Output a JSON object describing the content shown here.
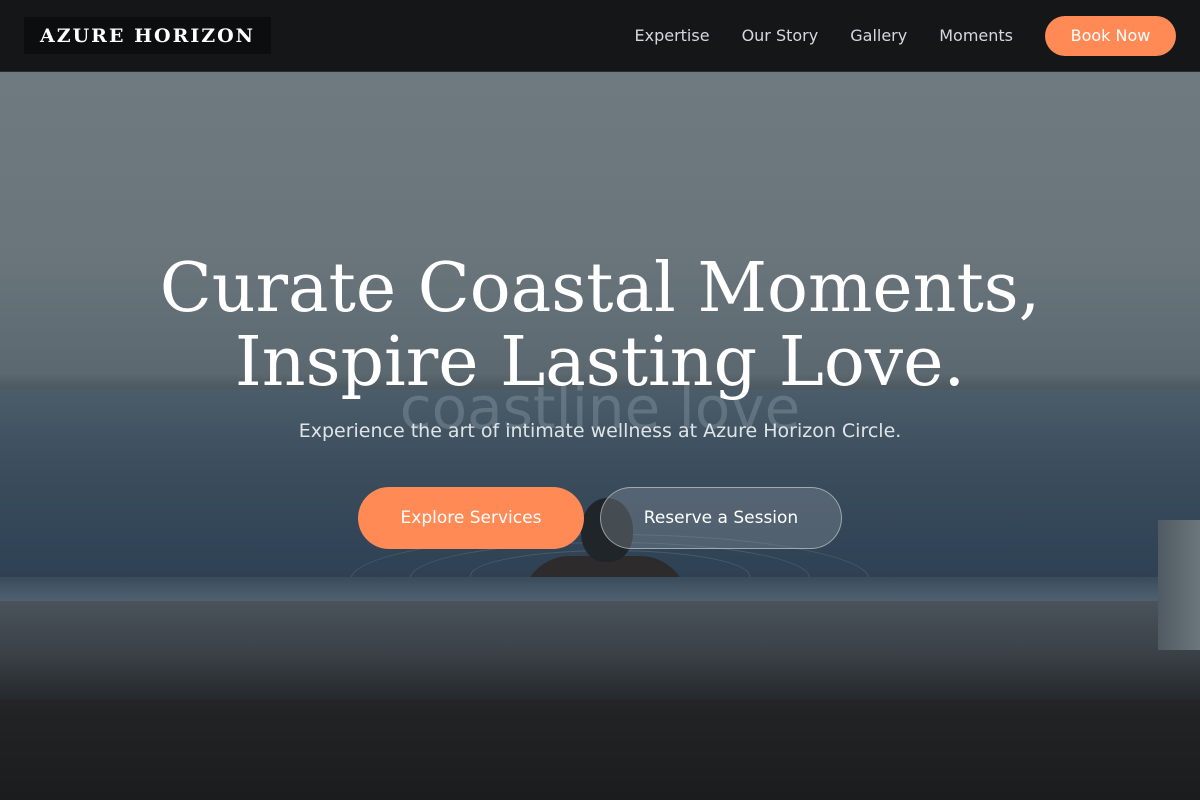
{
  "brand": {
    "logo": "AZURE HORIZON"
  },
  "nav": {
    "links": [
      "Expertise",
      "Our Story",
      "Gallery",
      "Moments"
    ],
    "cta": "Book Now"
  },
  "hero": {
    "title_line1": "Curate Coastal Moments,",
    "title_line2": "Inspire Lasting Love.",
    "background_text": "coastline love",
    "subtitle": "Experience the art of intimate wellness at Azure Horizon Circle.",
    "primary_button": "Explore Services",
    "secondary_button": "Reserve a Session"
  },
  "colors": {
    "accent": "#ff8a56",
    "header_bg": "#141618",
    "text_light": "#ffffff"
  }
}
